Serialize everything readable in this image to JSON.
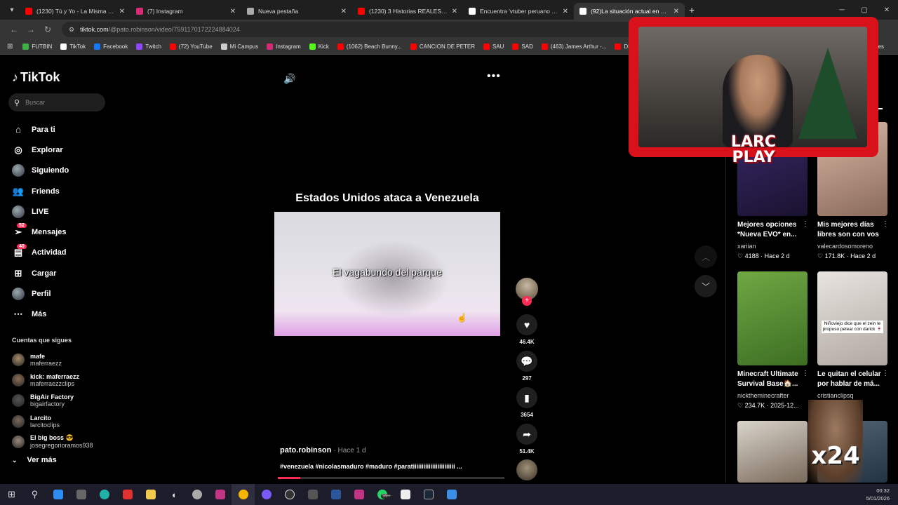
{
  "browser": {
    "tabs": [
      {
        "title": "(1230) Tú y Yo - La Misma Gente",
        "color": "#ff0000"
      },
      {
        "title": "(7) Instagram",
        "color": "#d62976"
      },
      {
        "title": "Nueva pestaña",
        "color": "#aaaaaa"
      },
      {
        "title": "(1230) 3 Historias REALES de Horror",
        "color": "#ff0000"
      },
      {
        "title": "Encuentra 'vtuber peruano hombre'",
        "color": "#ffffff"
      },
      {
        "title": "(92)La situación actual en Venezuela",
        "color": "#ffffff"
      }
    ],
    "url_host": "tiktok.com",
    "url_path": "/@pato.robinson/video/7591170172224884024",
    "bookmarks": [
      {
        "label": "FUTBIN",
        "color": "#3cb043"
      },
      {
        "label": "TikTok",
        "color": "#ffffff"
      },
      {
        "label": "Facebook",
        "color": "#1877f2"
      },
      {
        "label": "Twitch",
        "color": "#9146ff"
      },
      {
        "label": "(72) YouTube",
        "color": "#ff0000"
      },
      {
        "label": "Mi Campus",
        "color": "#cccccc"
      },
      {
        "label": "Instagram",
        "color": "#d62976"
      },
      {
        "label": "Kick",
        "color": "#53fc18"
      },
      {
        "label": "(1062) Beach Bunny...",
        "color": "#ff0000"
      },
      {
        "label": "CANCION DE PETER",
        "color": "#ff0000"
      },
      {
        "label": "SAU",
        "color": "#ff0000"
      },
      {
        "label": "SAD",
        "color": "#ff0000"
      },
      {
        "label": "(463) James Arthur -...",
        "color": "#ff0000"
      },
      {
        "label": "DRA",
        "color": "#ff0000"
      }
    ],
    "bookmarks_right": "adores"
  },
  "sidebar": {
    "logo": "TikTok",
    "search_placeholder": "Buscar",
    "items": [
      {
        "label": "Para ti",
        "icon": "home-icon",
        "glyph": "⌂"
      },
      {
        "label": "Explorar",
        "icon": "compass-icon",
        "glyph": "◎"
      },
      {
        "label": "Siguiendo",
        "icon": "avatar",
        "glyph": ""
      },
      {
        "label": "Friends",
        "icon": "friends-icon",
        "glyph": "👥"
      },
      {
        "label": "LIVE",
        "icon": "avatar",
        "glyph": ""
      },
      {
        "label": "Mensajes",
        "icon": "send-icon",
        "glyph": "➢",
        "badge": "52"
      },
      {
        "label": "Actividad",
        "icon": "inbox-icon",
        "glyph": "▤",
        "badge": "40"
      },
      {
        "label": "Cargar",
        "icon": "plus-box-icon",
        "glyph": "⊞"
      },
      {
        "label": "Perfil",
        "icon": "avatar",
        "glyph": ""
      },
      {
        "label": "Más",
        "icon": "more-icon",
        "glyph": "⋯"
      }
    ],
    "following_title": "Cuentas que sigues",
    "following": [
      {
        "name": "mafe",
        "handle": "maferraezz",
        "color": "#a68a6a"
      },
      {
        "name": "kick: maferraezz",
        "handle": "maferraezzclips",
        "color": "#8b6f55"
      },
      {
        "name": "BigAir Factory",
        "handle": "bigairfactory",
        "color": "#555555"
      },
      {
        "name": "Larcito",
        "handle": "larcitoclips",
        "color": "#7a6a60"
      },
      {
        "name": "El big boss 😎",
        "handle": "josegregorioramos938",
        "color": "#9a8a7a"
      }
    ],
    "see_more": "Ver más"
  },
  "video": {
    "title": "Estados Unidos ataca a Venezuela",
    "caption": "El vagabundo del parque",
    "author": "pato.robinson",
    "time": "Hace 1 d",
    "hashtags": "#venezuela #nicolasmaduro #maduro #paratiiiiiiiiiiiiiiiiiiiiiiii ...",
    "progress": 0.1,
    "likes": "46.4K",
    "comments": "297",
    "saves": "3654",
    "shares": "51.4K"
  },
  "right_panel": {
    "tab_label": "te",
    "cards": [
      {
        "title": "Mejores opciones *Nueva EVO* en...",
        "author": "xariian",
        "likes": "4188",
        "date": "Hace 2 d",
        "bg1": "#3a2a6a",
        "bg2": "#1a1230"
      },
      {
        "title": "Mis mejores días libres son con vos",
        "author": "valecardosomoreno",
        "likes": "171.8K",
        "date": "Hace 2 d",
        "bg1": "#d9b8a5",
        "bg2": "#8a6a5a"
      },
      {
        "title": "Minecraft Ultimate Survival Base🏠...",
        "author": "nicktheminecrafter",
        "likes": "234.7K",
        "date": "2025-12...",
        "bg1": "#6fa844",
        "bg2": "#3d6e22"
      },
      {
        "title": "Le quitan el celular por hablar de má...",
        "author": "cristianclipsq",
        "likes": "",
        "date": "2025-12-20",
        "bg1": "#e8e4e0",
        "bg2": "#b0a8a0"
      },
      {
        "title": "",
        "author": "",
        "likes": "",
        "date": "",
        "bg1": "#d9d5cc",
        "bg2": "#7a6a5a"
      },
      {
        "title": "",
        "author": "",
        "likes": "",
        "date": "",
        "bg1": "#556677",
        "bg2": "#223344"
      }
    ],
    "card4_overlay": "Niñoviejo dice que el zein le propuso pelear con darick 🍷"
  },
  "overlay": {
    "brand": "LARC PLAY",
    "brand_line1": "LARC",
    "brand_line2": "PLAY",
    "sticker": "x24"
  },
  "taskbar": {
    "time": "00:32",
    "date": "5/01/2026",
    "whatsapp_badge": "99+"
  }
}
